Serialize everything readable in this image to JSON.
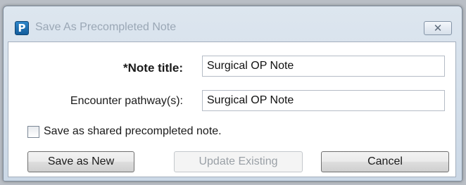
{
  "window": {
    "title": "Save As Precompleted Note",
    "app_icon_letter": "P",
    "close_glyph": "✕",
    "app_icon": "app-logo-icon",
    "close_icon": "close-icon"
  },
  "form": {
    "note_title_label": "*Note title:",
    "note_title_value": "Surgical OP Note",
    "pathway_label": "Encounter pathway(s):",
    "pathway_value": "Surgical OP Note",
    "shared_checkbox_label": "Save as shared precompleted note.",
    "shared_checked": false
  },
  "buttons": {
    "save_new": "Save as New",
    "update_existing": "Update Existing",
    "cancel": "Cancel"
  },
  "colors": {
    "accent": "#1e74b8",
    "disabled_text": "#9aa0a6"
  }
}
